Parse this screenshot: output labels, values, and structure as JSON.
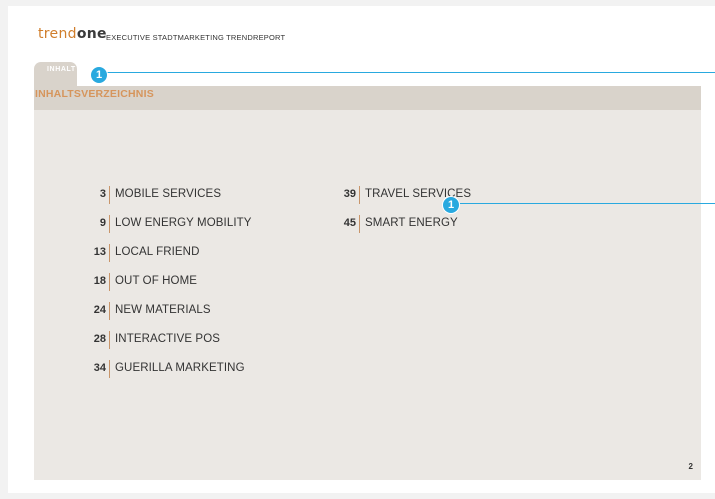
{
  "header": {
    "logo_part1": "trend",
    "logo_part2": "one",
    "title": "EXECUTIVE STADTMARKETING TRENDREPORT"
  },
  "tab": {
    "label": "INHALT"
  },
  "section": {
    "title": "INHALTSVERZEICHNIS"
  },
  "toc": {
    "left": [
      {
        "page": "3",
        "label": "MOBILE SERVICES"
      },
      {
        "page": "9",
        "label": "LOW ENERGY MOBILITY"
      },
      {
        "page": "13",
        "label": "LOCAL FRIEND"
      },
      {
        "page": "18",
        "label": "OUT OF HOME"
      },
      {
        "page": "24",
        "label": "NEW MATERIALS"
      },
      {
        "page": "28",
        "label": "INTERACTIVE POS"
      },
      {
        "page": "34",
        "label": "GUERILLA MARKETING"
      }
    ],
    "right": [
      {
        "page": "39",
        "label": "TRAVEL SERVICES"
      },
      {
        "page": "45",
        "label": "SMART ENERGY"
      }
    ]
  },
  "page_number": "2",
  "annotations": [
    {
      "marker": "1"
    },
    {
      "marker": "1"
    }
  ],
  "colors": {
    "accent_orange": "#d07e2c",
    "bar_bg": "#d9d3cb",
    "content_bg": "#ebe8e4",
    "callout_blue": "#29a9df"
  }
}
